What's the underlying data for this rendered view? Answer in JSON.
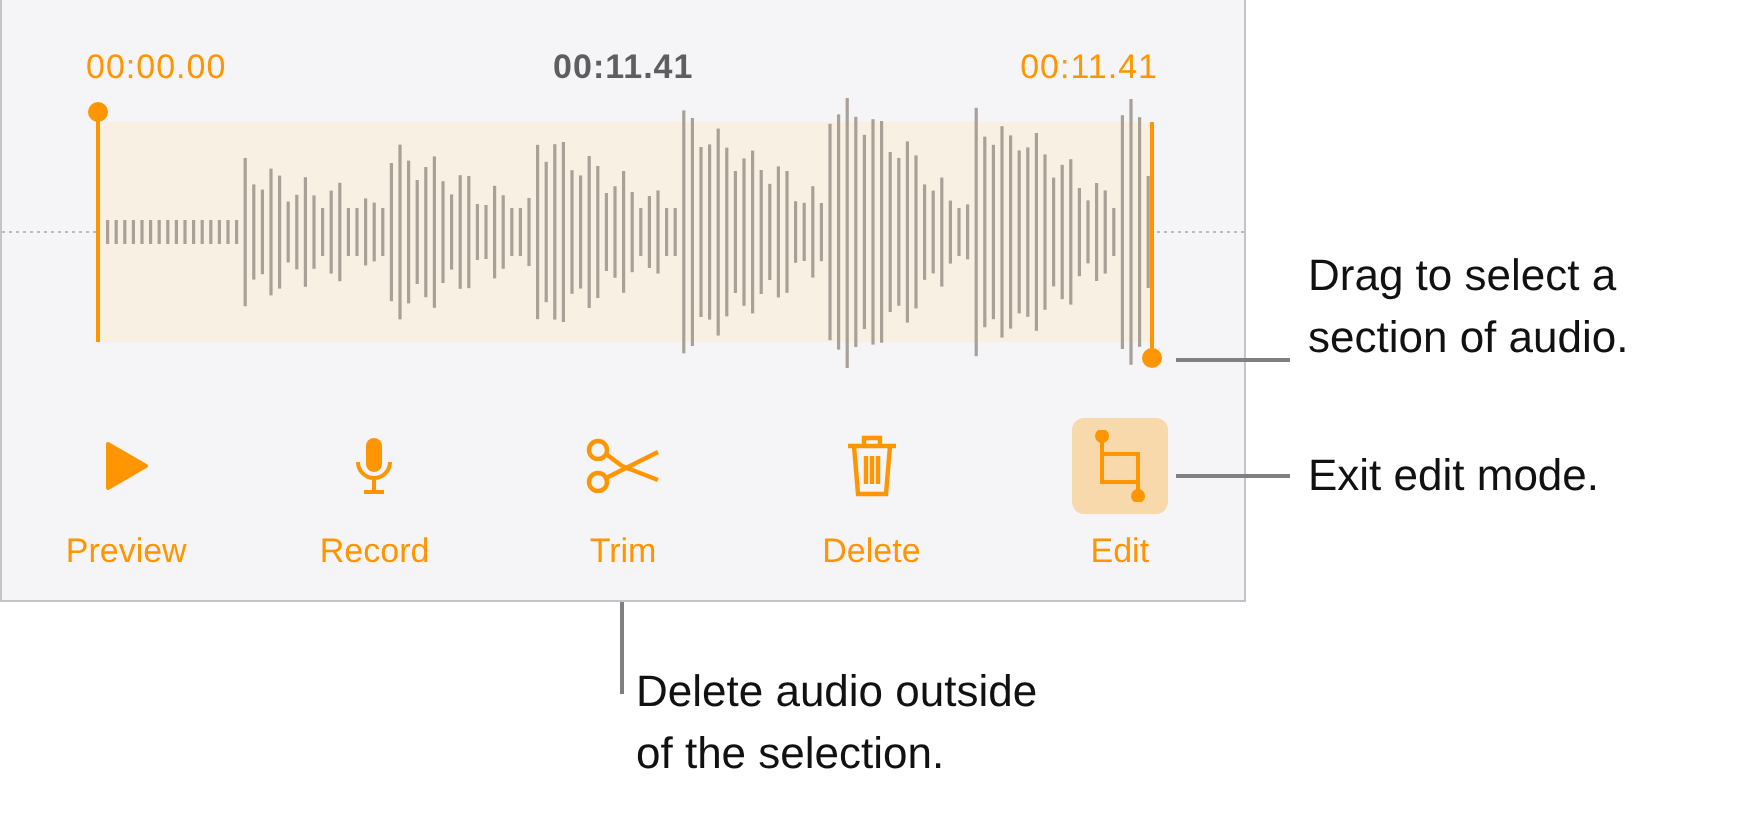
{
  "times": {
    "start": "00:00.00",
    "duration": "00:11.41",
    "end": "00:11.41"
  },
  "buttons": [
    {
      "kind": "play",
      "label": "Preview",
      "selected": false
    },
    {
      "kind": "mic",
      "label": "Record",
      "selected": false
    },
    {
      "kind": "scissors",
      "label": "Trim",
      "selected": false
    },
    {
      "kind": "trash",
      "label": "Delete",
      "selected": false
    },
    {
      "kind": "crop",
      "label": "Edit",
      "selected": true
    }
  ],
  "callouts": [
    {
      "text": "Drag to select a\nsection of audio."
    },
    {
      "text": "Exit edit mode."
    },
    {
      "text": "Delete audio outside\nof the selection."
    }
  ]
}
